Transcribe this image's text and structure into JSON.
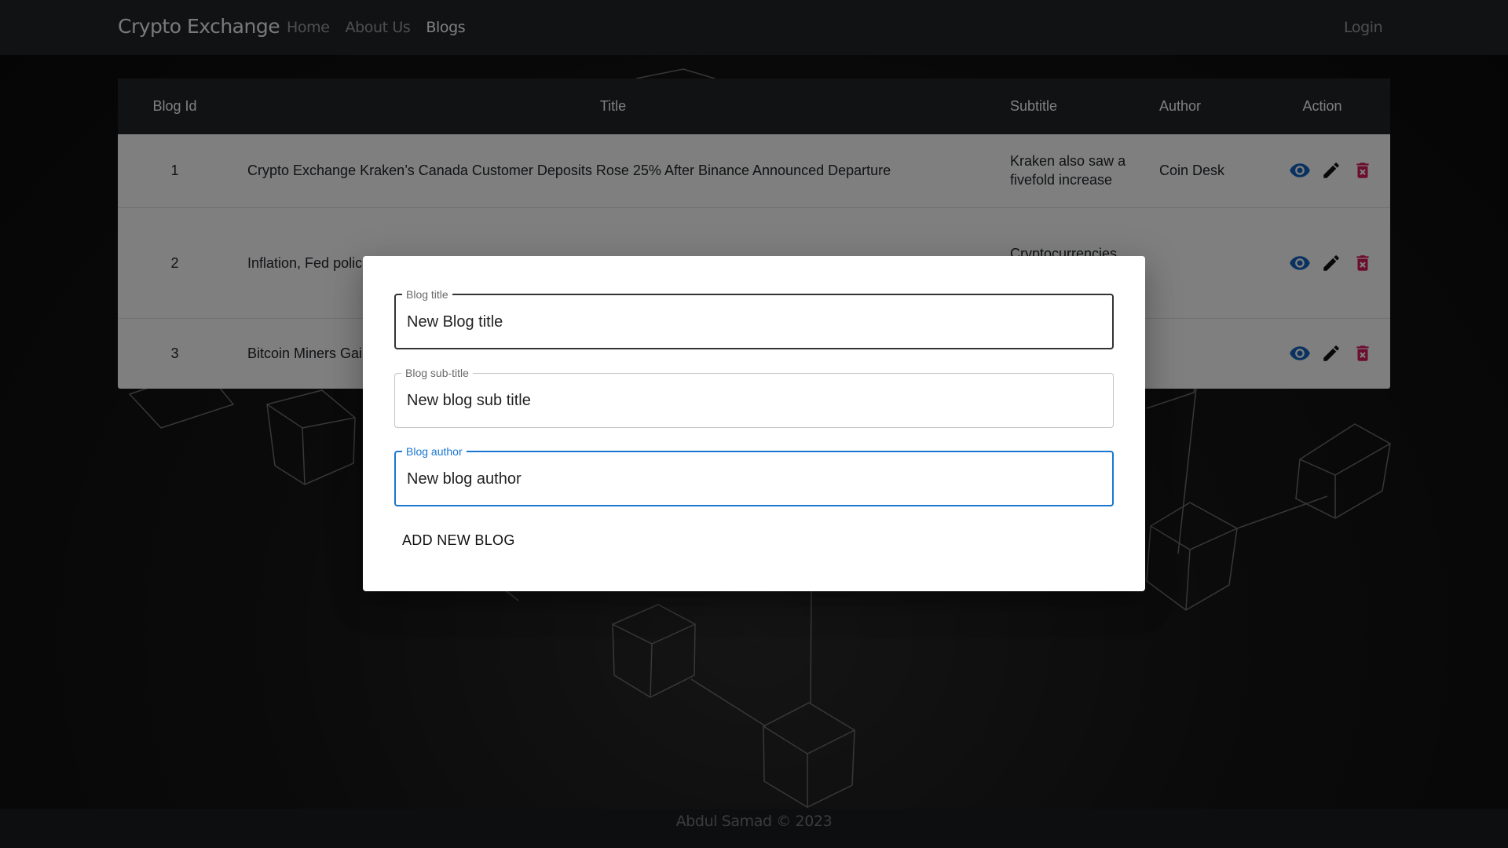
{
  "navbar": {
    "brand": "Crypto Exchange",
    "links": [
      "Home",
      "About Us",
      "Blogs"
    ],
    "login": "Login"
  },
  "table": {
    "headers": [
      "Blog Id",
      "Title",
      "Subtitle",
      "Author",
      "Action"
    ],
    "rows": [
      {
        "id": "1",
        "title": "Crypto Exchange Kraken’s Canada Customer Deposits Rose 25% After Binance Announced Departure",
        "subtitle": "Kraken also saw a fivefold increase",
        "author": "Coin Desk"
      },
      {
        "id": "2",
        "title": "Inflation, Fed polic",
        "subtitle": "Cryptocurrencies are preparing for",
        "author": ""
      },
      {
        "id": "3",
        "title": "Bitcoin Miners Gai",
        "subtitle": "",
        "author": ""
      }
    ]
  },
  "dialog": {
    "fields": [
      {
        "label": "Blog title",
        "value": "New Blog title"
      },
      {
        "label": "Blog sub-title",
        "value": "New blog sub title"
      },
      {
        "label": "Blog author",
        "value": "New blog author"
      }
    ],
    "submit": "ADD NEW BLOG"
  },
  "footer": "Abdul Samad © 2023",
  "colors": {
    "view": "#1565c0",
    "edit": "#111111",
    "delete": "#d81b60",
    "focus": "#1976d2"
  }
}
